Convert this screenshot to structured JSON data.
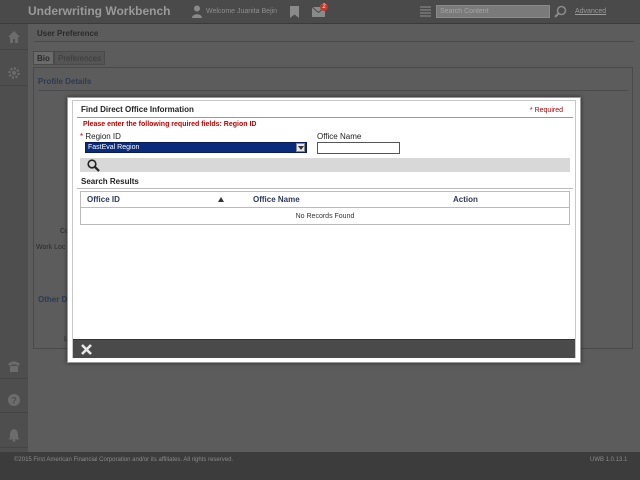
{
  "app": {
    "title": "Underwriting Workbench",
    "welcome": "Welcome Juanita Bejin",
    "mail_count": "2",
    "search_placeholder": "Search Content",
    "advanced_label": "Advanced"
  },
  "rail": {
    "icons": [
      "home-icon",
      "gear-icon",
      "phone-icon",
      "help-icon",
      "bell-icon"
    ]
  },
  "page": {
    "title": "User Preference",
    "tabs": [
      {
        "label": "Bio",
        "active": true
      },
      {
        "label": "Preferences",
        "active": false
      }
    ],
    "section_profile": "Profile Details",
    "fragment_co": "Co",
    "fragment_work": "Work Loc",
    "section_other": "Other D",
    "fragment_l": "L"
  },
  "modal": {
    "title": "Find Direct Office Information",
    "required_note": "* Required",
    "error_message": "Please enter the following required fields: Region ID",
    "region_label_star": "*",
    "region_label": "Region ID",
    "region_selected": "FastEval Region",
    "office_name_label": "Office Name",
    "office_name_value": "",
    "search_results_title": "Search Results",
    "columns": [
      "Office ID",
      "Office Name",
      "Action"
    ],
    "empty_message": "No Records Found"
  },
  "footer": {
    "copyright": "©2015 First American Financial Corporation and/or its affiliates. All rights reserved.",
    "version": "UWB 1.0.13.1"
  },
  "colors": {
    "error": "#c00000",
    "select_bg": "#0a2a7a",
    "header_text": "#2d3a5a"
  }
}
